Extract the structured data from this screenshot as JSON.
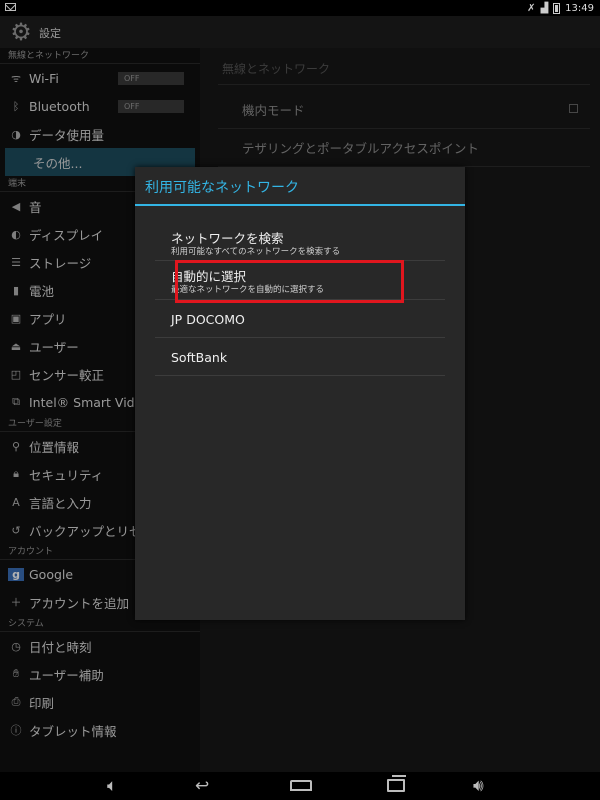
{
  "status": {
    "time": "13:49"
  },
  "app": {
    "title": "設定"
  },
  "left": {
    "wireless_section": "無線とネットワーク",
    "wifi": "Wi-Fi",
    "wifi_toggle": "OFF",
    "bluetooth": "Bluetooth",
    "bluetooth_toggle": "OFF",
    "data_usage": "データ使用量",
    "more": "その他...",
    "device_section": "端末",
    "sound": "音",
    "display": "ディスプレイ",
    "storage": "ストレージ",
    "battery": "電池",
    "apps": "アプリ",
    "users": "ユーザー",
    "sensor": "センサー較正",
    "intel": "Intel® Smart Video",
    "user_settings_section": "ユーザー設定",
    "location": "位置情報",
    "security": "セキュリティ",
    "language": "言語と入力",
    "backup": "バックアップとリセ",
    "account_section": "アカウント",
    "google": "Google",
    "add_account": "アカウントを追加",
    "system_section": "システム",
    "datetime": "日付と時刻",
    "accessibility": "ユーザー補助",
    "print": "印刷",
    "about": "タブレット情報"
  },
  "right": {
    "header": "無線とネットワーク",
    "airplane": "機内モード",
    "tethering": "テザリングとポータブルアクセスポイント"
  },
  "dialog": {
    "title": "利用可能なネットワーク",
    "options": [
      {
        "title": "ネットワークを検索",
        "sub": "利用可能なすべてのネットワークを検索する"
      },
      {
        "title": "自動的に選択",
        "sub": "最適なネットワークを自動的に選択する"
      },
      {
        "title": "JP DOCOMO"
      },
      {
        "title": "SoftBank"
      }
    ]
  },
  "colors": {
    "accent": "#33b5e5",
    "highlight": "#e0161e",
    "selected": "#1e4c5e"
  }
}
